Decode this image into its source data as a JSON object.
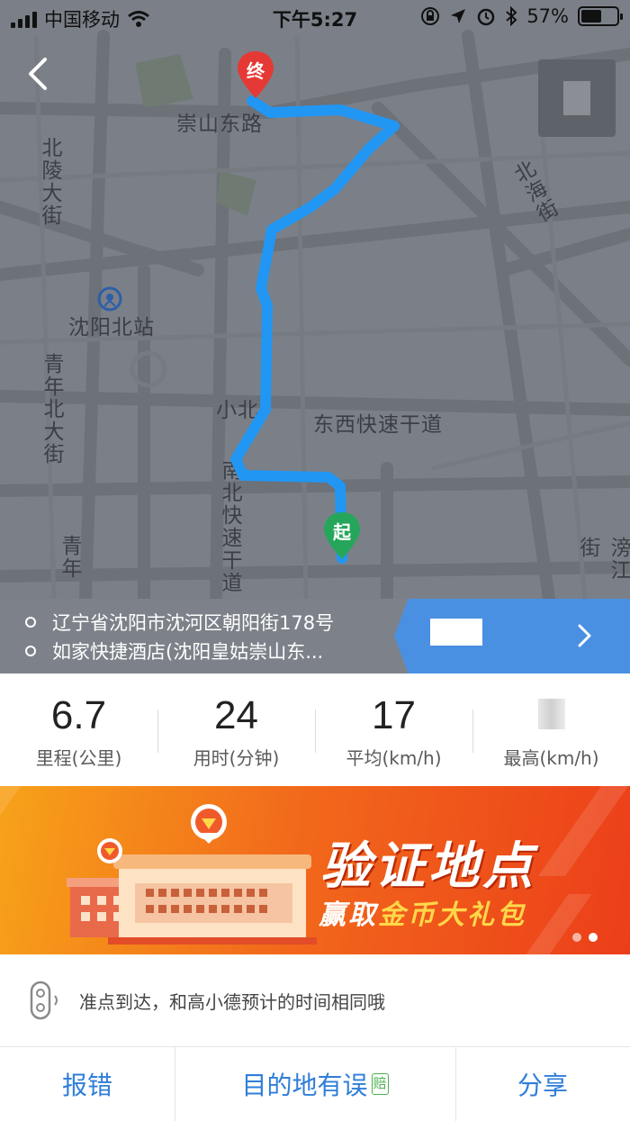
{
  "status_bar": {
    "carrier": "中国移动",
    "time": "下午5:27",
    "battery_percent": "57%",
    "battery_level": 0.57
  },
  "map": {
    "labels": {
      "chongshan_east": "崇山东路",
      "beiling": "北陵大街",
      "beihai": "北海街",
      "shenyang_north": "沈阳北站",
      "qingnian_north": "青年北大街",
      "xiaobei": "小北",
      "dongxi": "东西快速干道",
      "nanbei": "南北快速干道",
      "qingnian": "青年",
      "pangjiang": "滂江街"
    },
    "markers": {
      "end": "终",
      "start": "起"
    },
    "colors": {
      "route": "#2196f3",
      "end_marker": "#e53935",
      "start_marker": "#26a65b"
    }
  },
  "addresses": {
    "origin": "辽宁省沈阳市沈河区朝阳街178号",
    "destination": "如家快捷酒店(沈阳皇姑崇山东..."
  },
  "stats": [
    {
      "value": "6.7",
      "label": "里程(公里)"
    },
    {
      "value": "24",
      "label": "用时(分钟)"
    },
    {
      "value": "17",
      "label": "平均(km/h)"
    },
    {
      "value": "",
      "label": "最高(km/h)"
    }
  ],
  "banner": {
    "title": "验证地点",
    "sub_prefix": "赢取",
    "sub_highlight": "金币大礼包"
  },
  "tip": {
    "text": "准点到达，和高小德预计的时间相同哦"
  },
  "actions": {
    "report": "报错",
    "destination_error": "目的地有误",
    "badge": "赔",
    "share": "分享"
  }
}
